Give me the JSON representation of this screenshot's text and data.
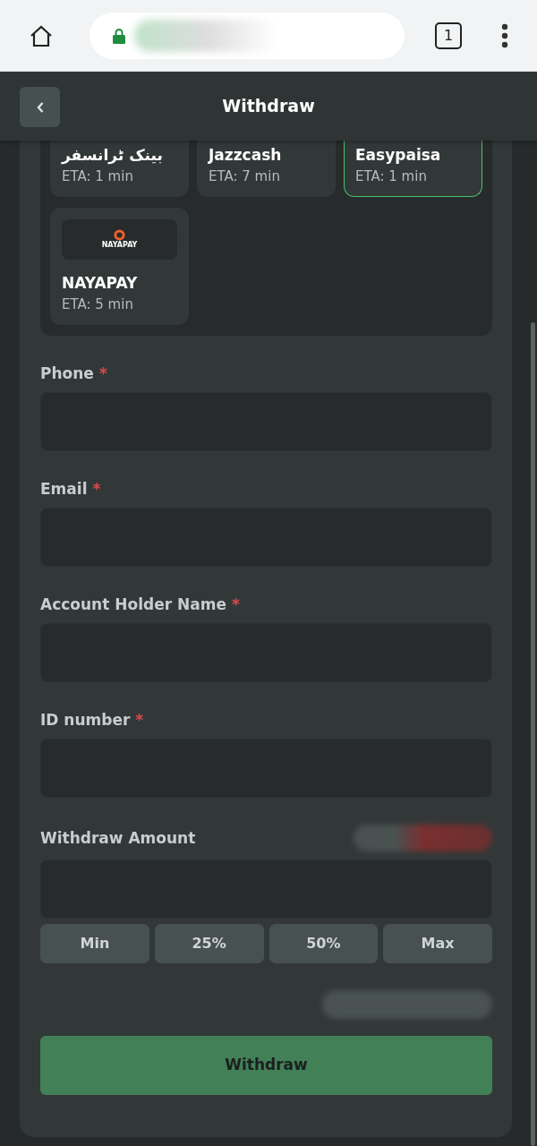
{
  "browser": {
    "tab_count": "1"
  },
  "header": {
    "title": "Withdraw"
  },
  "methods": [
    {
      "name": "بینک ٹرانسفر",
      "eta": "ETA: 1 min",
      "selected": false
    },
    {
      "name": "Jazzcash",
      "eta": "ETA: 7 min",
      "selected": false
    },
    {
      "name": "Easypaisa",
      "eta": "ETA: 1 min",
      "selected": true
    },
    {
      "name": "NAYAPAY",
      "eta": "ETA: 5 min",
      "selected": false,
      "logo_text": "NAYAPAY"
    }
  ],
  "fields": [
    {
      "label": "Phone",
      "required_mark": "*"
    },
    {
      "label": "Email",
      "required_mark": "*"
    },
    {
      "label": "Account Holder Name",
      "required_mark": "*"
    },
    {
      "label": "ID number",
      "required_mark": "*"
    }
  ],
  "amount": {
    "label": "Withdraw Amount",
    "quick": [
      "Min",
      "25%",
      "50%",
      "Max"
    ]
  },
  "submit": "Withdraw"
}
